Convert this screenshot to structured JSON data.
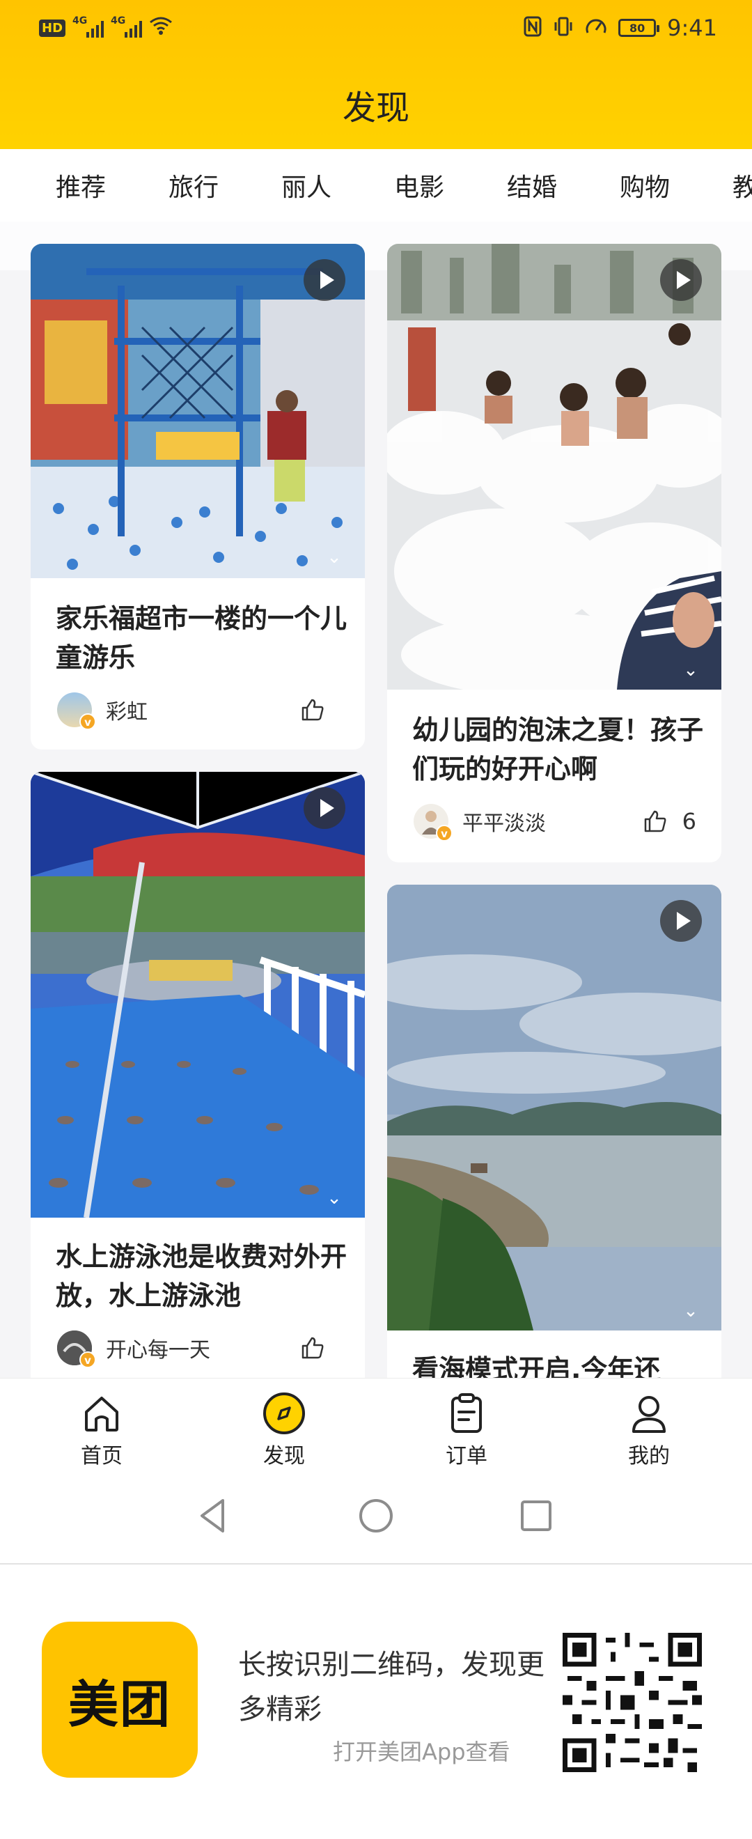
{
  "status_bar": {
    "left_badge": "HD",
    "network_1": "4G",
    "network_2": "4G",
    "battery": "80",
    "time": "9:41"
  },
  "header": {
    "title": "发现"
  },
  "tabs": [
    "推荐",
    "旅行",
    "丽人",
    "电影",
    "结婚",
    "购物",
    "教"
  ],
  "cards": [
    {
      "title": "家乐福超市一楼的一个儿童游乐",
      "author": "彩虹",
      "likes": "",
      "verified_badge": "v"
    },
    {
      "title": "幼儿园的泡沫之夏！孩子们玩的好开心啊",
      "author": "平平淡淡",
      "likes": "6",
      "verified_badge": "v"
    },
    {
      "title": "水上游泳池是收费对外开放，水上游泳池",
      "author": "开心每一天",
      "likes": "",
      "verified_badge": "v"
    },
    {
      "title": "看海模式开启,今年还",
      "author": "",
      "likes": "",
      "verified_badge": ""
    }
  ],
  "bottom_nav": [
    {
      "label": "首页",
      "icon": "home-icon"
    },
    {
      "label": "发现",
      "icon": "compass-icon"
    },
    {
      "label": "订单",
      "icon": "order-clipboard-icon"
    },
    {
      "label": "我的",
      "icon": "profile-icon"
    }
  ],
  "promo": {
    "logo_text": "美团",
    "text": "长按识别二维码，发现更多精彩",
    "sub": "打开美团App查看"
  },
  "colors": {
    "brand_yellow": "#FFD200",
    "like_badge": "#F5A623"
  }
}
